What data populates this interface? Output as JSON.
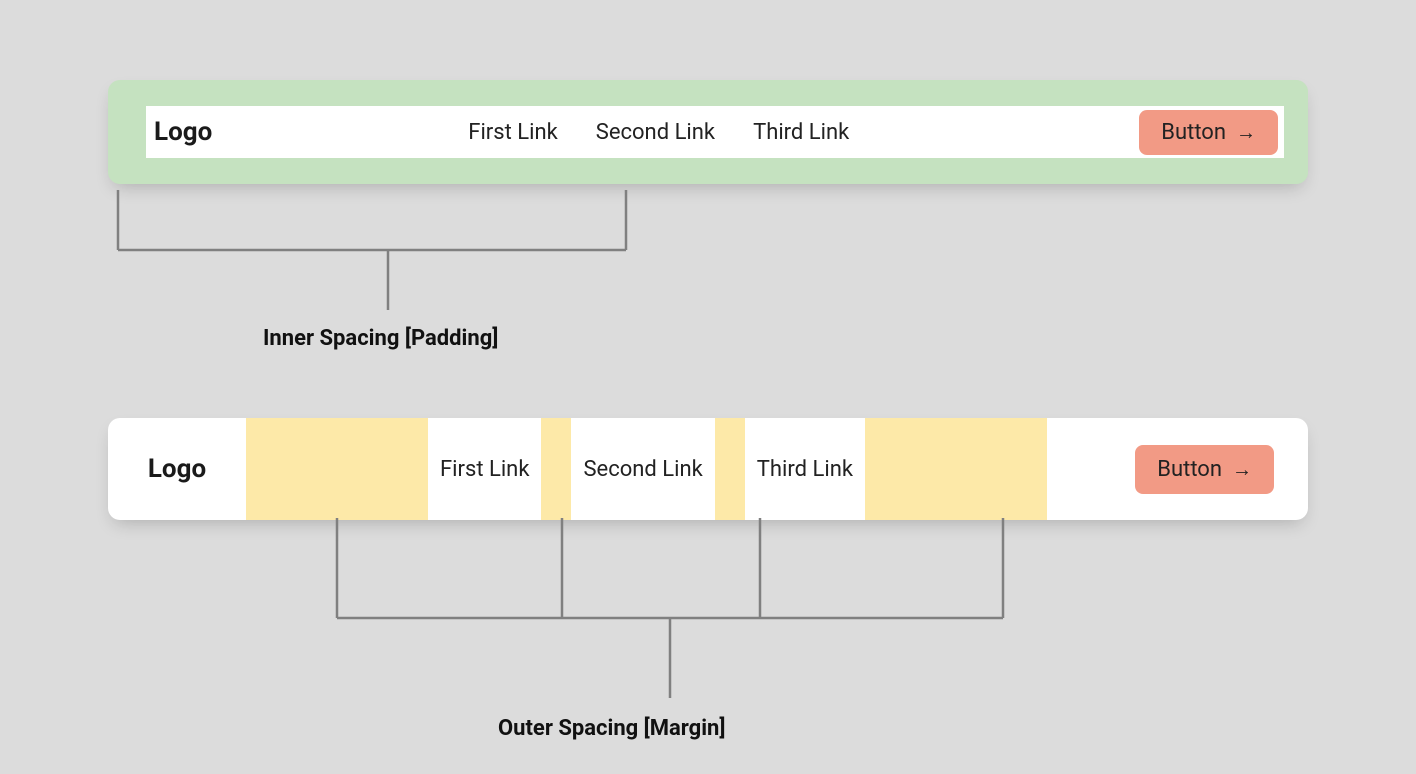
{
  "colors": {
    "padding_highlight": "#c5e2c0",
    "margin_highlight": "#fde9a8",
    "button": "#f29a85",
    "annotation": "#808080",
    "background": "#dcdcdc"
  },
  "example1": {
    "logo": "Logo",
    "links": [
      "First Link",
      "Second Link",
      "Third Link"
    ],
    "button_label": "Button",
    "arrow": "→",
    "annotation_label": "Inner Spacing [Padding]"
  },
  "example2": {
    "logo": "Logo",
    "links": [
      "First Link",
      "Second Link",
      "Third Link"
    ],
    "button_label": "Button",
    "arrow": "→",
    "annotation_label": "Outer Spacing [Margin]"
  }
}
